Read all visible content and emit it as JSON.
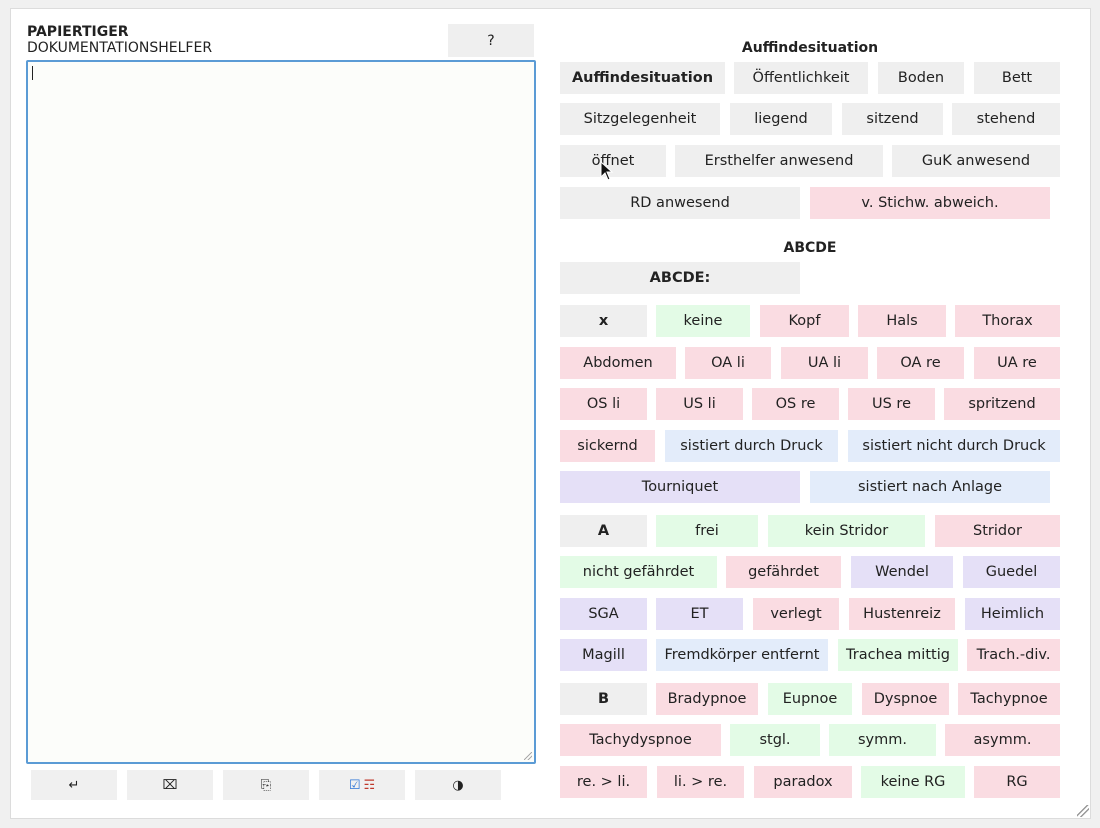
{
  "header": {
    "title": "PAPIERTIGER",
    "subtitle": "DOKUMENTATIONSHELFER",
    "help_label": "?"
  },
  "editor": {
    "value": ""
  },
  "toolbar": {
    "enter": "↵",
    "clear": "⌧",
    "copy": "⎘",
    "checklist_check": "☑",
    "checklist_list": "☶",
    "theme": "◑"
  },
  "sections": {
    "auffinde": {
      "heading": "Auffindesituation",
      "buttons": [
        "Auffindesituation",
        "Öffentlichkeit",
        "Boden",
        "Bett",
        "Sitzgelegenheit",
        "liegend",
        "sitzend",
        "stehend",
        "öffnet",
        "Ersthelfer anwesend",
        "GuK anwesend",
        "RD anwesend",
        "v. Stichw. abweich."
      ]
    },
    "abcde": {
      "heading": "ABCDE",
      "buttons": [
        "ABCDE:"
      ]
    },
    "x": {
      "buttons": [
        "x",
        "keine",
        "Kopf",
        "Hals",
        "Thorax",
        "Abdomen",
        "OA li",
        "UA li",
        "OA re",
        "UA re",
        "OS li",
        "US li",
        "OS re",
        "US re",
        "spritzend",
        "sickernd",
        "sistiert durch Druck",
        "sistiert nicht durch Druck",
        "Tourniquet",
        "sistiert nach Anlage"
      ]
    },
    "a": {
      "buttons": [
        "A",
        "frei",
        "kein Stridor",
        "Stridor",
        "nicht gefährdet",
        "gefährdet",
        "Wendel",
        "Guedel",
        "SGA",
        "ET",
        "verlegt",
        "Hustenreiz",
        "Heimlich",
        "Magill",
        "Fremdkörper entfernt",
        "Trachea mittig",
        "Trach.-div."
      ]
    },
    "b": {
      "buttons": [
        "B",
        "Bradypnoe",
        "Eupnoe",
        "Dyspnoe",
        "Tachypnoe",
        "Tachydyspnoe",
        "stgl.",
        "symm.",
        "asymm.",
        "re. > li.",
        "li. > re.",
        "paradox",
        "keine RG",
        "RG"
      ]
    }
  }
}
